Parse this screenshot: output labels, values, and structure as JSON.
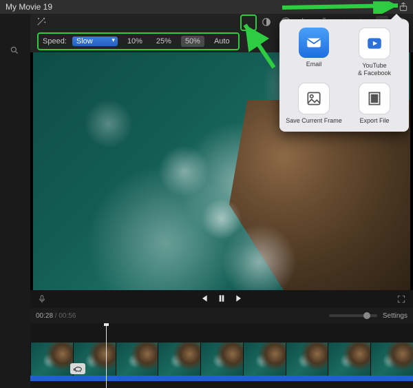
{
  "titlebar": {
    "title": "My Movie 19"
  },
  "toolbar": {
    "icons": [
      "contrast-icon",
      "palette-icon",
      "crop-icon",
      "stabilize-icon",
      "volume-icon",
      "noise-icon",
      "speed-icon",
      "info-icon"
    ],
    "wand": "✦"
  },
  "speed": {
    "label": "Speed:",
    "selected": "Slow",
    "options": [
      "10%",
      "25%",
      "50%",
      "Auto"
    ],
    "active_option": "50%"
  },
  "transport": {
    "prev": "prev",
    "pause": "pause",
    "next": "next"
  },
  "timeline": {
    "current": "00:28",
    "total": "00:56",
    "settings_label": "Settings",
    "clip_thumbs": 9
  },
  "share": {
    "items": [
      {
        "id": "email",
        "label": "Email"
      },
      {
        "id": "youtube-facebook",
        "label": "YouTube\n& Facebook"
      },
      {
        "id": "save-frame",
        "label": "Save Current Frame"
      },
      {
        "id": "export-file",
        "label": "Export File"
      }
    ]
  },
  "annotation": {
    "color": "#2ecc40"
  }
}
